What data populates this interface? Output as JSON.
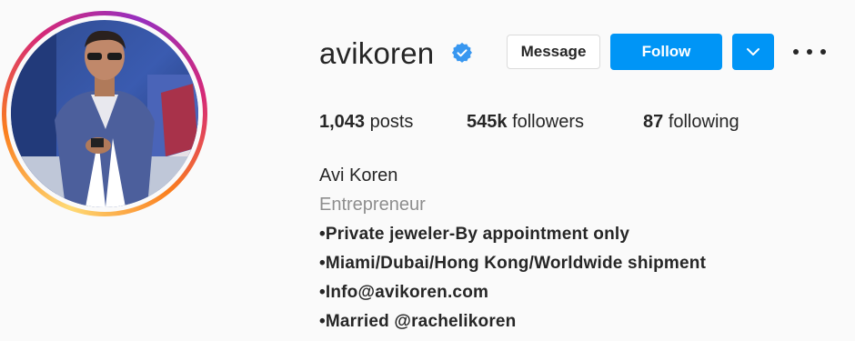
{
  "profile": {
    "username": "avikoren",
    "verified": true,
    "verified_icon": "verified-badge-icon",
    "avatar_icon": "profile-photo"
  },
  "actions": {
    "message_label": "Message",
    "follow_label": "Follow",
    "suggest_icon": "chevron-down-icon",
    "more_icon": "more-options-icon"
  },
  "stats": {
    "posts_count": "1,043",
    "posts_label": "posts",
    "followers_count": "545k",
    "followers_label": "followers",
    "following_count": "87",
    "following_label": "following"
  },
  "bio": {
    "full_name": "Avi Koren",
    "category": "Entrepreneur",
    "lines": [
      "•Private jeweler-By appointment only",
      "•Miami/Dubai/Hong Kong/Worldwide shipment",
      "•Info@avikoren.com",
      "•Married @rachelikoren"
    ]
  },
  "colors": {
    "accent": "#0095f6",
    "text": "#262626",
    "muted": "#8e8e8e",
    "background": "#fafafa",
    "verified": "#3897f0"
  }
}
